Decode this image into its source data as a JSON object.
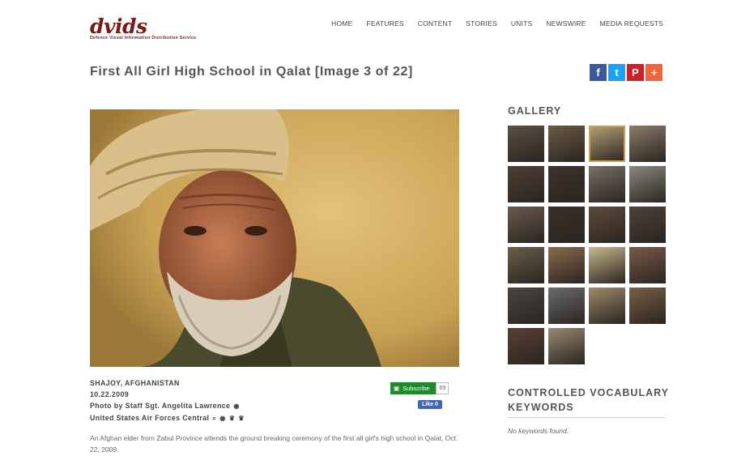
{
  "logo": {
    "word": "dvids",
    "tagline": "Defense Visual Information Distribution Service"
  },
  "nav": [
    "HOME",
    "FEATURES",
    "CONTENT",
    "STORIES",
    "UNITS",
    "NEWSWIRE",
    "MEDIA REQUESTS"
  ],
  "title": "First All Girl High School in Qalat [Image 3 of 22]",
  "share": [
    {
      "name": "facebook-icon",
      "glyph": "f",
      "color": "#3b5998"
    },
    {
      "name": "twitter-icon",
      "glyph": "t",
      "color": "#1da1f2"
    },
    {
      "name": "pinterest-icon",
      "glyph": "P",
      "color": "#cb2027"
    },
    {
      "name": "more-share-icon",
      "glyph": "+",
      "color": "#f0653a"
    }
  ],
  "meta": {
    "location": "SHAJOY, AFGHANISTAN",
    "date": "10.22.2009",
    "photo_by": "Photo by Staff Sgt. Angelita Lawrence",
    "unit": "United States Air Forces Central"
  },
  "subscribe": {
    "label": "Subscribe",
    "count": "69"
  },
  "like": {
    "label": "Like 0"
  },
  "caption": "An Afghan elder from Zabul Province attends the ground breaking ceremony of the first all girl's high school in Qalat, Oct. 22, 2009.",
  "gallery": {
    "title": "GALLERY",
    "thumb_colors": [
      "#5a5046",
      "#6b5a45",
      "#b8a27a",
      "#8b7d6a",
      "#4e3f35",
      "#3d342c",
      "#7a7066",
      "#8a8a80",
      "#6a5a4d",
      "#3a302a",
      "#5f4b3c",
      "#4d4238",
      "#6a5f4a",
      "#8a6b4c",
      "#c9b890",
      "#7a5a4a",
      "#4a4540",
      "#6a6a70",
      "#a08a6a",
      "#7a5f45",
      "#5a4035",
      "#9a8a70"
    ],
    "selected_index": 2
  },
  "keywords": {
    "title": "CONTROLLED VOCABULARY KEYWORDS",
    "empty": "No keywords found."
  }
}
